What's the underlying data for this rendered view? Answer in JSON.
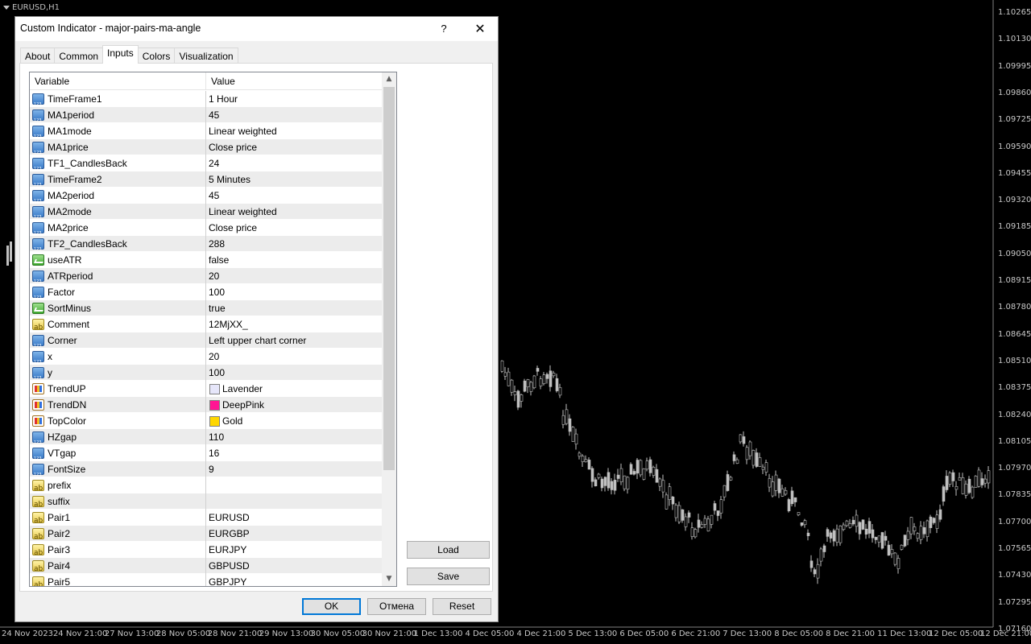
{
  "chart": {
    "symbol_label": "EURUSD,H1",
    "price_axis": [
      "1.10265",
      "1.10130",
      "1.09995",
      "1.09860",
      "1.09725",
      "1.09590",
      "1.09455",
      "1.09320",
      "1.09185",
      "1.09050",
      "1.08915",
      "1.08780",
      "1.08645",
      "1.08510",
      "1.08375",
      "1.08240",
      "1.08105",
      "1.07970",
      "1.07835",
      "1.07700",
      "1.07565",
      "1.07430",
      "1.07295",
      "1.07160"
    ],
    "time_axis": [
      "24 Nov 2023",
      "24 Nov 21:00",
      "27 Nov 13:00",
      "28 Nov 05:00",
      "28 Nov 21:00",
      "29 Nov 13:00",
      "30 Nov 05:00",
      "30 Nov 21:00",
      "1 Dec 13:00",
      "4 Dec 05:00",
      "4 Dec 21:00",
      "5 Dec 13:00",
      "6 Dec 05:00",
      "6 Dec 21:00",
      "7 Dec 13:00",
      "8 Dec 05:00",
      "8 Dec 21:00",
      "11 Dec 13:00",
      "12 Dec 05:00",
      "12 Dec 21:00"
    ],
    "colors": {
      "background": "#000000",
      "candle": "#c0c0c0",
      "axis_text": "#c8c8c8"
    }
  },
  "dialog": {
    "title": "Custom Indicator - major-pairs-ma-angle",
    "help_label": "?",
    "tabs": [
      {
        "label": "About"
      },
      {
        "label": "Common"
      },
      {
        "label": "Inputs",
        "active": true
      },
      {
        "label": "Colors"
      },
      {
        "label": "Visualization"
      }
    ],
    "grid": {
      "col_variable": "Variable",
      "col_value": "Value",
      "rows": [
        {
          "type": "num",
          "name": "TimeFrame1",
          "value": "1 Hour"
        },
        {
          "type": "num",
          "name": "MA1period",
          "value": "45"
        },
        {
          "type": "num",
          "name": "MA1mode",
          "value": "Linear weighted"
        },
        {
          "type": "num",
          "name": "MA1price",
          "value": "Close price"
        },
        {
          "type": "num",
          "name": "TF1_CandlesBack",
          "value": "24"
        },
        {
          "type": "num",
          "name": "TimeFrame2",
          "value": "5 Minutes"
        },
        {
          "type": "num",
          "name": "MA2period",
          "value": "45"
        },
        {
          "type": "num",
          "name": "MA2mode",
          "value": "Linear weighted"
        },
        {
          "type": "num",
          "name": "MA2price",
          "value": "Close price"
        },
        {
          "type": "num",
          "name": "TF2_CandlesBack",
          "value": "288"
        },
        {
          "type": "bool",
          "name": "useATR",
          "value": "false"
        },
        {
          "type": "num",
          "name": "ATRperiod",
          "value": "20"
        },
        {
          "type": "num",
          "name": "Factor",
          "value": "100"
        },
        {
          "type": "bool",
          "name": "SortMinus",
          "value": "true"
        },
        {
          "type": "str",
          "name": "Comment",
          "value": "12MjXX_"
        },
        {
          "type": "num",
          "name": "Corner",
          "value": "Left upper chart corner"
        },
        {
          "type": "num",
          "name": "x",
          "value": "20"
        },
        {
          "type": "num",
          "name": "y",
          "value": "100"
        },
        {
          "type": "color",
          "name": "TrendUP",
          "value": "Lavender",
          "swatch": "#e6e6fa"
        },
        {
          "type": "color",
          "name": "TrendDN",
          "value": "DeepPink",
          "swatch": "#ff1493"
        },
        {
          "type": "color",
          "name": "TopColor",
          "value": "Gold",
          "swatch": "#ffd700"
        },
        {
          "type": "num",
          "name": "HZgap",
          "value": "110"
        },
        {
          "type": "num",
          "name": "VTgap",
          "value": "16"
        },
        {
          "type": "num",
          "name": "FontSize",
          "value": "9"
        },
        {
          "type": "str",
          "name": "prefix",
          "value": ""
        },
        {
          "type": "str",
          "name": "suffix",
          "value": ""
        },
        {
          "type": "str",
          "name": "Pair1",
          "value": "EURUSD"
        },
        {
          "type": "str",
          "name": "Pair2",
          "value": "EURGBP"
        },
        {
          "type": "str",
          "name": "Pair3",
          "value": "EURJPY"
        },
        {
          "type": "str",
          "name": "Pair4",
          "value": "GBPUSD"
        },
        {
          "type": "str",
          "name": "Pair5",
          "value": "GBPJPY"
        }
      ]
    },
    "load_label": "Load",
    "save_label": "Save",
    "ok_label": "OK",
    "cancel_label": "Отмена",
    "reset_label": "Reset"
  }
}
